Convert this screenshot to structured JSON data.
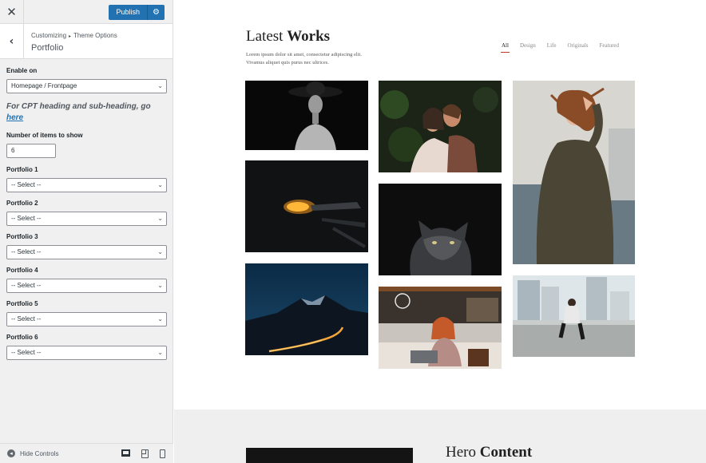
{
  "topbar": {
    "close_icon": "close-icon",
    "publish_label": "Publish",
    "publish_settings_icon": "gear-icon"
  },
  "section": {
    "breadcrumb_root": "Customizing",
    "breadcrumb_sub": "Theme Options",
    "title": "Portfolio"
  },
  "controls": {
    "enable_on_label": "Enable on",
    "enable_on_value": "Homepage / Frontpage",
    "note_text": "For CPT heading and sub-heading, go",
    "note_link": "here",
    "items_label": "Number of items to show",
    "items_value": "6",
    "portfolio_selects": [
      {
        "label": "Portfolio 1",
        "value": "-- Select --"
      },
      {
        "label": "Portfolio 2",
        "value": "-- Select --"
      },
      {
        "label": "Portfolio 3",
        "value": "-- Select --"
      },
      {
        "label": "Portfolio 4",
        "value": "-- Select --"
      },
      {
        "label": "Portfolio 5",
        "value": "-- Select --"
      },
      {
        "label": "Portfolio 6",
        "value": "-- Select --"
      }
    ]
  },
  "footer": {
    "hide_controls_label": "Hide Controls",
    "devices": [
      "desktop-icon",
      "tablet-icon",
      "mobile-icon"
    ]
  },
  "preview": {
    "latest_works_prefix": "Latest",
    "latest_works_bold": "Works",
    "description_line1": "Lorem ipsum dolor sit amet, consectetur adipiscing elit.",
    "description_line2": "Vivamus aliquet quis purus nec ultrices.",
    "filters": [
      "All",
      "Design",
      "Life",
      "Originals",
      "Featured"
    ],
    "active_filter": "All",
    "photos": [
      "woman-in-hat-photo",
      "couple-photo",
      "woman-sweater-photo",
      "glowing-ember-photo",
      "cat-photo",
      "mountain-night-photo",
      "cafe-woman-photo",
      "city-rooftop-photo"
    ],
    "hero_prefix": "Hero",
    "hero_bold": "Content"
  }
}
